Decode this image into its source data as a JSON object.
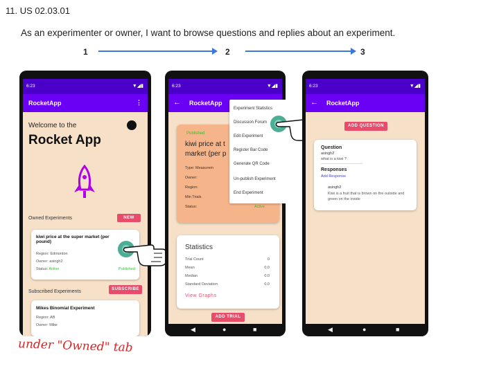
{
  "heading": "11. US 02.03.01",
  "story": "As an experimenter or owner, I want to browse questions and replies about an experiment.",
  "steps": [
    "1",
    "2",
    "3"
  ],
  "colors": {
    "purple": "#6a00f4",
    "accent": "#e74c6b",
    "arrow": "#3c78d8",
    "background": "#f6e0c8"
  },
  "phone1": {
    "time": "6:23",
    "app_title": "RocketApp",
    "welcome": "Welcome to the",
    "big_title": "Rocket App",
    "owned_label": "Owned Experiments",
    "new_btn": "NEW",
    "card_title": "kiwi price at the super market (per pound)",
    "region": "Region: Edmonton",
    "owner": "Owner: asingh2",
    "status_label": "Status:",
    "status_value": "Active",
    "published": "Published",
    "subscribed_label": "Subscribed Experiments",
    "subscribe_btn": "SUBSCRIBE",
    "sub_title": "Mikes Binomial Experiment",
    "sub_region": "Region: AB",
    "sub_owner": "Owner: Mike"
  },
  "phone2": {
    "time": "6:23",
    "app_title": "RocketApp",
    "published": "Published",
    "title": "kiwi price at t market (per p",
    "type": "Type:",
    "type_val": "Measurem",
    "owner": "Owner:",
    "region": "Region:",
    "min_trials": "Min Trials",
    "status": "Status:",
    "status_val": "Active",
    "menu": [
      "Experiment Statistics",
      "Discussion Forum",
      "Edit Experiment",
      "Register Bar Code",
      "Generate QR Code",
      "Un-publish Experiment",
      "End Experiment"
    ],
    "stats_title": "Statistics",
    "stats": [
      {
        "label": "Trial Count",
        "value": "0"
      },
      {
        "label": "Mean",
        "value": "0.0"
      },
      {
        "label": "Median",
        "value": "0.0"
      },
      {
        "label": "Standard Deviation",
        "value": "0.0"
      }
    ],
    "view_graphs": "View Graphs",
    "add_trial": "ADD TRIAL"
  },
  "phone3": {
    "time": "6:23",
    "app_title": "RocketApp",
    "add_question": "ADD QUESTION",
    "question_label": "Question",
    "question_user": "asingh2",
    "question_text": "what is a kiwi ?",
    "responses_label": "Responses",
    "add_response": "Add Response",
    "response_user": "asingh2",
    "response_text": "Kiwi is a fruit that is brown on the outside and green on the inside"
  },
  "note": "under \"Owned\" tab"
}
